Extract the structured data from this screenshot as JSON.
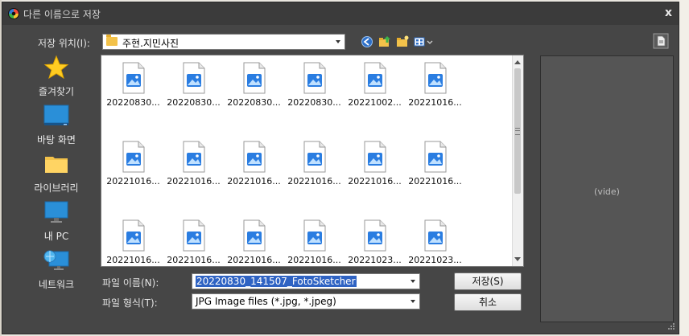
{
  "window": {
    "title": "다른 이름으로 저장",
    "close_label": "x"
  },
  "location": {
    "label": "저장 위치(I):",
    "value": "주현.지민사진"
  },
  "sidebar": {
    "items": [
      {
        "label": "즐겨찾기",
        "icon": "star-icon"
      },
      {
        "label": "바탕 화면",
        "icon": "desktop-icon"
      },
      {
        "label": "라이브러리",
        "icon": "folder-icon"
      },
      {
        "label": "내 PC",
        "icon": "monitor-icon"
      },
      {
        "label": "네트워크",
        "icon": "network-icon"
      }
    ]
  },
  "files": {
    "rows": [
      [
        "20220830...",
        "20220830...",
        "20220830...",
        "20220830...",
        "20221002...",
        "20221016..."
      ],
      [
        "20221016...",
        "20221016...",
        "20221016...",
        "20221016...",
        "20221016...",
        "20221016..."
      ],
      [
        "20221016...",
        "20221016...",
        "20221016...",
        "20221016...",
        "20221023...",
        "20221023..."
      ]
    ]
  },
  "form": {
    "filename_label": "파일 이름(N):",
    "filename_value": "20220830_141507_FotoSketcher",
    "filetype_label": "파일 형식(T):",
    "filetype_value": "JPG Image files (*.jpg, *.jpeg)"
  },
  "buttons": {
    "save": "저장(S)",
    "cancel": "취소"
  },
  "preview": {
    "text": "(vide)"
  },
  "colors": {
    "window_bg": "#464646",
    "selection": "#2f63c3",
    "file_icon_blue": "#2a7de1"
  }
}
